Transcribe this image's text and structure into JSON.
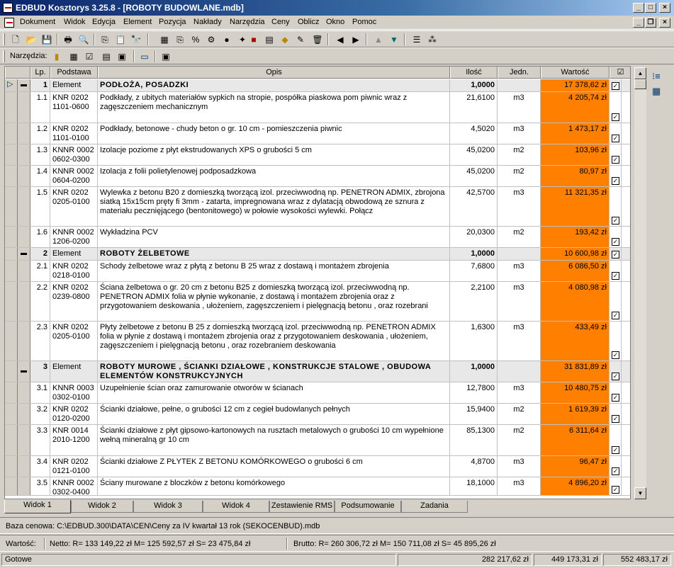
{
  "window": {
    "title": "EDBUD Kosztorys 3.25.8 - [ROBOTY BUDOWLANE.mdb]"
  },
  "menu": [
    "Dokument",
    "Widok",
    "Edycja",
    "Element",
    "Pozycja",
    "Nakłady",
    "Narzędzia",
    "Ceny",
    "Oblicz",
    "Okno",
    "Pomoc"
  ],
  "toolbar2": {
    "label": "Narzędzia:"
  },
  "columns": {
    "lp": "Lp.",
    "podstawa": "Podstawa",
    "opis": "Opis",
    "ilosc": "Ilość",
    "jedn": "Jedn.",
    "wartosc": "Wartość"
  },
  "rows": [
    {
      "type": "element",
      "lp": "1",
      "podstawa": "Element",
      "opis": "PODŁOŻA, POSADZKI",
      "ilosc": "1,0000",
      "jedn": "",
      "wartosc": "17 378,62 zł"
    },
    {
      "type": "pos",
      "lp": "1.1",
      "podstawa": "KNR 0202 1101-0600",
      "opis": "Podkłady, z ubitych materiałów sypkich na stropie, pospółka piaskowa pom piwnic wraz z zagęszczeniem mechanicznym",
      "ilosc": "21,6100",
      "jedn": "m3",
      "wartosc": "4 205,74 zł"
    },
    {
      "type": "pos",
      "lp": "1.2",
      "podstawa": "KNR 0202 1101-0100",
      "opis": "Podkłady, betonowe - chudy beton o gr. 10 cm - pomieszczenia piwnic",
      "ilosc": "4,5020",
      "jedn": "m3",
      "wartosc": "1 473,17 zł"
    },
    {
      "type": "pos",
      "lp": "1.3",
      "podstawa": "KNNR 0002 0602-0300",
      "opis": "Izolacje poziome z płyt ekstrudowanych XPS o grubości 5 cm",
      "ilosc": "45,0200",
      "jedn": "m2",
      "wartosc": "103,96 zł"
    },
    {
      "type": "pos",
      "lp": "1.4",
      "podstawa": "KNNR 0002 0604-0200",
      "opis": "Izolacja z folii polietylenowej podposadzkowa",
      "ilosc": "45,0200",
      "jedn": "m2",
      "wartosc": "80,97 zł"
    },
    {
      "type": "pos",
      "lp": "1.5",
      "podstawa": "KNR 0202 0205-0100",
      "opis": "Wylewka z betonu B20 z domieszką tworzącą izol. przeciwwodną np. PENETRON ADMIX, zbrojona siatką 15x15cm pręty fi 3mm - zatarta, impregnowana wraz z dylatacją obwodową ze sznura z materiału pecznięjącego (bentonitowego) w połowie wysokości wylewki. Połącz",
      "ilosc": "42,5700",
      "jedn": "m3",
      "wartosc": "11 321,35 zł"
    },
    {
      "type": "pos",
      "lp": "1.6",
      "podstawa": "KNNR 0002 1206-0200",
      "opis": "Wykładzina PCV",
      "ilosc": "20,0300",
      "jedn": "m2",
      "wartosc": "193,42 zł"
    },
    {
      "type": "element",
      "lp": "2",
      "podstawa": "Element",
      "opis": "ROBOTY ŻELBETOWE",
      "ilosc": "1,0000",
      "jedn": "",
      "wartosc": "10 600,98 zł"
    },
    {
      "type": "pos",
      "lp": "2.1",
      "podstawa": "KNR 0202 0218-0100",
      "opis": "Schody żelbetowe wraz z płytą z betonu B 25 wraz z dostawą i montażem zbrojenia",
      "ilosc": "7,6800",
      "jedn": "m3",
      "wartosc": "6 086,50 zł"
    },
    {
      "type": "pos",
      "lp": "2.2",
      "podstawa": "KNR 0202 0239-0800",
      "opis": "Ściana żelbetowa o gr. 20 cm z betonu B25 z domieszką tworzącą izol. przeciwwodną np. PENETRON ADMIX folia w płynie wykonanie, z dostawą i montażem zbrojenia oraz z przygotowaniem deskowania , ułożeniem, zagęszczeniem i pielęgnacją betonu , oraz rozebrani",
      "ilosc": "2,2100",
      "jedn": "m3",
      "wartosc": "4 080,98 zł"
    },
    {
      "type": "pos",
      "lp": "2.3",
      "podstawa": "KNR 0202 0205-0100",
      "opis": "Płyty żelbetowe z betonu B 25 z domieszką tworzącą izol. przeciwwodną np. PENETRON ADMIX folia w płynie z dostawą i montażem zbrojenia oraz z przygotowaniem deskowania , ułożeniem, zagęszczeniem i pielęgnacją betonu , oraz rozebraniem deskowania",
      "ilosc": "1,6300",
      "jedn": "m3",
      "wartosc": "433,49 zł"
    },
    {
      "type": "element",
      "lp": "3",
      "podstawa": "Element",
      "opis": "ROBOTY MUROWE , ŚCIANKI DZIAŁOWE , KONSTRUKCJE STALOWE , OBUDOWA ELEMENTÓW KONSTRUKCYJNYCH",
      "ilosc": "1,0000",
      "jedn": "",
      "wartosc": "31 831,89 zł"
    },
    {
      "type": "pos",
      "lp": "3.1",
      "podstawa": "KNNR 0003 0302-0100",
      "opis": "Uzupełnienie ścian oraz zamurowanie otworów w ścianach",
      "ilosc": "12,7800",
      "jedn": "m3",
      "wartosc": "10 480,75 zł"
    },
    {
      "type": "pos",
      "lp": "3.2",
      "podstawa": "KNR 0202 0120-0200",
      "opis": "Ścianki działowe, pełne, o grubości 12 cm z cegieł budowlanych pełnych",
      "ilosc": "15,9400",
      "jedn": "m2",
      "wartosc": "1 619,39 zł"
    },
    {
      "type": "pos",
      "lp": "3.3",
      "podstawa": "KNR 0014 2010-1200",
      "opis": "Ścianki działowe z płyt gipsowo-kartonowych na rusztach metalowych o grubości 10 cm wypełnione wełną mineralną gr 10 cm",
      "ilosc": "85,1300",
      "jedn": "m2",
      "wartosc": "6 311,64 zł"
    },
    {
      "type": "pos",
      "lp": "3.4",
      "podstawa": "KNR 0202 0121-0100",
      "opis": "Ścianki działowe Z PŁYTEK Z BETONU KOMÓRKOWEGO o grubości 6 cm",
      "ilosc": "4,8700",
      "jedn": "m3",
      "wartosc": "96,47 zł"
    },
    {
      "type": "pos",
      "lp": "3.5",
      "podstawa": "KNNR 0002 0302-0400",
      "opis": "Ściany murowane z bloczków z betonu komórkowego",
      "ilosc": "18,1000",
      "jedn": "m3",
      "wartosc": "4 896,20 zł"
    }
  ],
  "tabs": [
    "Widok 1",
    "Widok 2",
    "Widok 3",
    "Widok 4",
    "Zestawienie RMS",
    "Podsumowanie",
    "Zadania"
  ],
  "baza": "Baza cenowa:  C:\\EDBUD.300\\DATA\\CEN\\Ceny za IV kwartał 13 rok (SEKOCENBUD).mdb",
  "wartosc": {
    "label": "Wartość:",
    "netto": "Netto:   R=   133 149,22 zł   M=   125 592,57 zł  S=   23 475,84 zł",
    "brutto": "Brutto:   R=   260 306,72 zł    M=   150 711,08 zł  S=   45 895,26 zł"
  },
  "status": {
    "text": "Gotowe",
    "v1": "282 217,62 zł",
    "v2": "449 173,31 zł",
    "v3": "552 483,17 zł"
  }
}
